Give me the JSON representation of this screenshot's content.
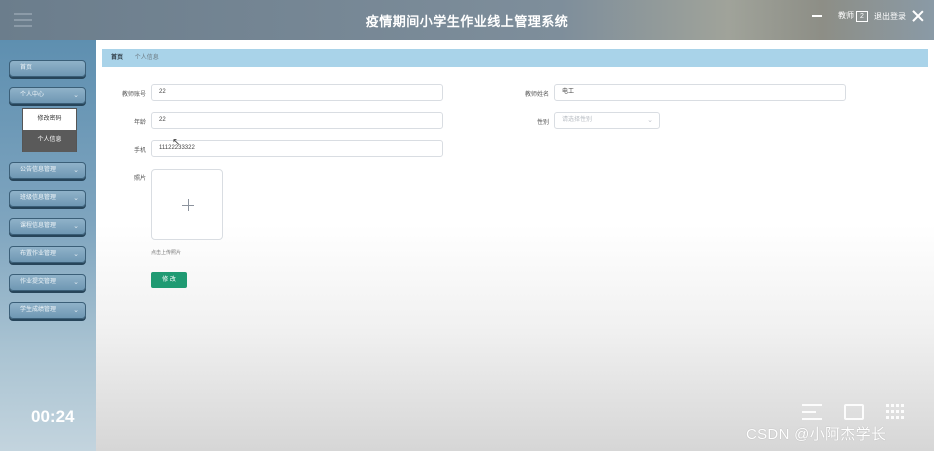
{
  "header": {
    "title": "疫情期间小学生作业线上管理系统",
    "role_label": "教师",
    "badge_text": "2",
    "logout_label": "退出登录"
  },
  "sidebar": {
    "items": [
      {
        "label": "首页"
      },
      {
        "label": "个人中心"
      },
      {
        "label": "公告信息管理"
      },
      {
        "label": "班级信息管理"
      },
      {
        "label": "课程信息管理"
      },
      {
        "label": "布置作业管理"
      },
      {
        "label": "作业提交管理"
      },
      {
        "label": "学生成绩管理"
      }
    ],
    "submenu": [
      {
        "label": "修改密码"
      },
      {
        "label": "个人信息"
      }
    ]
  },
  "breadcrumb": {
    "home": "首页",
    "current": "个人信息"
  },
  "form": {
    "account_label": "教师账号",
    "account_value": "22",
    "name_label": "教师姓名",
    "name_value": "电工",
    "age_label": "年龄",
    "age_value": "22",
    "gender_label": "性别",
    "gender_placeholder": "请选择性别",
    "phone_label": "手机",
    "phone_value": "11122233322",
    "photo_label": "照片",
    "upload_hint": "点击上传照片",
    "submit_label": "修 改"
  },
  "overlay": {
    "timer": "00:24",
    "watermark": "CSDN @小阿杰学长"
  }
}
